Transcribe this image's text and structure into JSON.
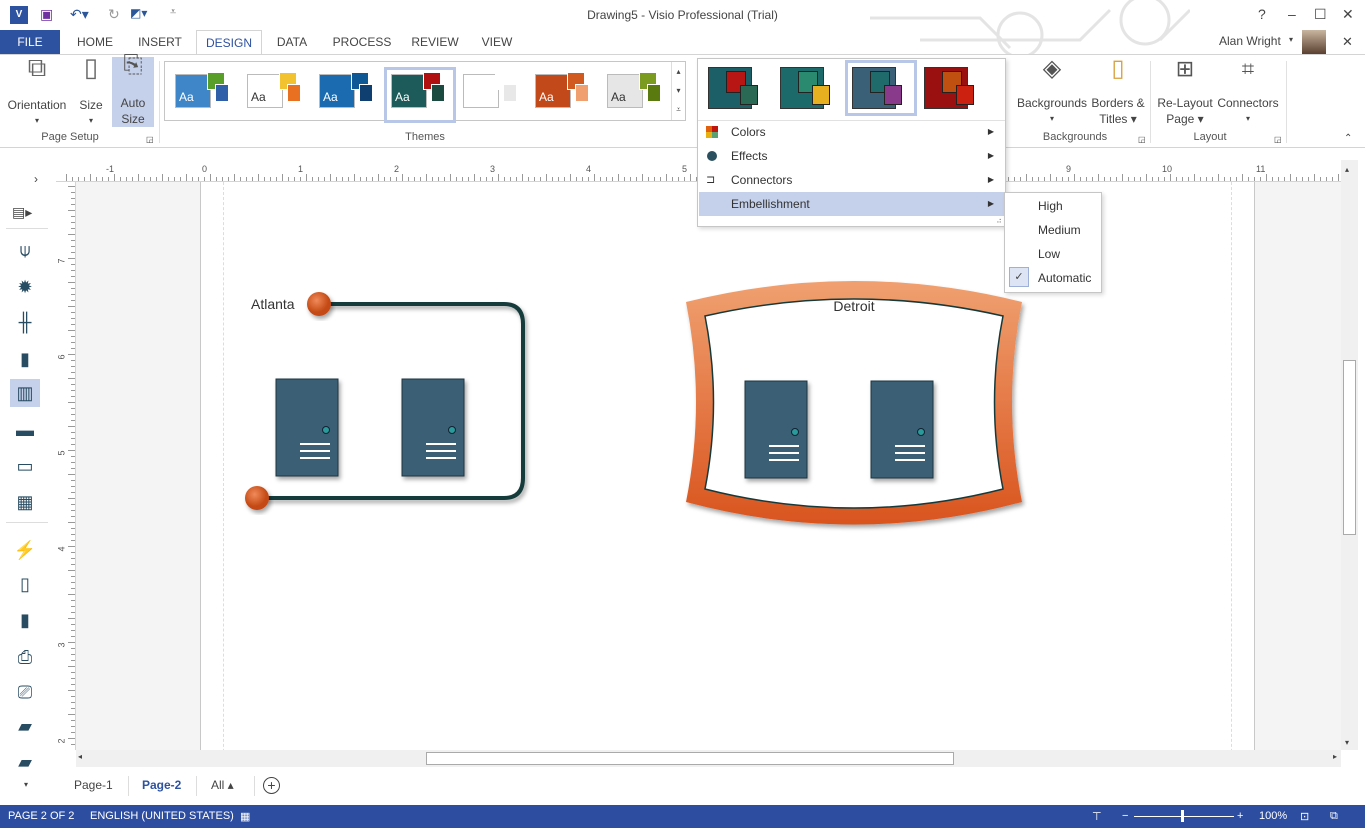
{
  "window": {
    "title": "Drawing5 - Visio Professional (Trial)",
    "user": "Alan Wright",
    "controls": [
      "?",
      "–",
      "☐",
      "✕"
    ]
  },
  "tabs": [
    {
      "label": "FILE"
    },
    {
      "label": "HOME"
    },
    {
      "label": "INSERT"
    },
    {
      "label": "DESIGN",
      "active": true
    },
    {
      "label": "DATA"
    },
    {
      "label": "PROCESS"
    },
    {
      "label": "REVIEW"
    },
    {
      "label": "VIEW"
    }
  ],
  "ribbon": {
    "page_setup": {
      "label": "Page Setup",
      "orientation": "Orientation",
      "size": "Size",
      "auto_size_1": "Auto",
      "auto_size_2": "Size"
    },
    "themes": {
      "label": "Themes",
      "sample": "Aa",
      "items": [
        {
          "bg": "#3f86c8",
          "a": "#5a9e2a",
          "b": "#2f5fa8"
        },
        {
          "bg": "#ffffff",
          "a": "#f2c230",
          "b": "#e87020"
        },
        {
          "bg": "#1b6bb0",
          "a": "#0e5896",
          "b": "#0e3f70"
        },
        {
          "bg": "#1d5a5a",
          "a": "#b01010",
          "b": "#1a4a40",
          "selected": true
        },
        {
          "bg": "#ffffff",
          "a": "#ffffff",
          "b": "#e8e8e8"
        },
        {
          "bg": "#c2491a",
          "a": "#d05a20",
          "b": "#f0a070"
        },
        {
          "bg": "#e6e6e6",
          "a": "#7a9a20",
          "b": "#5a7a10"
        }
      ]
    },
    "variants": [
      {
        "bg": "#1d5f66",
        "a": "#b81515",
        "b": "#2a6a55"
      },
      {
        "bg": "#1d6a6a",
        "a": "#2a8a70",
        "b": "#e6b020"
      },
      {
        "bg": "#3a6078",
        "a": "#1f6a6a",
        "b": "#8a3a8a",
        "selected": true
      },
      {
        "bg": "#9a1010",
        "a": "#c05010",
        "b": "#cc2010"
      }
    ],
    "backgrounds": {
      "label": "Backgrounds",
      "backgrounds": "Backgrounds",
      "borders_1": "Borders &",
      "borders_2": "Titles"
    },
    "layout": {
      "label": "Layout",
      "relayout_1": "Re-Layout",
      "relayout_2": "Page",
      "connectors": "Connectors"
    }
  },
  "variant_menu": {
    "items": [
      {
        "label": "Colors",
        "icon": "colors-icon"
      },
      {
        "label": "Effects",
        "icon": "effects-icon"
      },
      {
        "label": "Connectors",
        "icon": "connectors-icon"
      },
      {
        "label": "Embellishment",
        "highlighted": true
      }
    ]
  },
  "embellishment_submenu": {
    "items": [
      {
        "label": "High"
      },
      {
        "label": "Medium"
      },
      {
        "label": "Low"
      },
      {
        "label": "Automatic",
        "checked": true
      }
    ]
  },
  "rulers": {
    "horizontal": [
      "-1",
      "0",
      "1",
      "2",
      "3",
      "4",
      "5",
      "9",
      "10",
      "11"
    ],
    "vertical": [
      "7",
      "6",
      "5",
      "4",
      "3",
      "2"
    ]
  },
  "diagram": {
    "atlanta": "Atlanta",
    "detroit": "Detroit",
    "accent": "#d9541e",
    "server": "#3a5f74",
    "connector": "#163a3a"
  },
  "page_tabs": {
    "tabs": [
      "Page-1",
      "Page-2"
    ],
    "active": "Page-2",
    "all": "All ▴"
  },
  "status": {
    "page": "PAGE 2 OF 2",
    "language": "ENGLISH (UNITED STATES)",
    "zoom": "100%",
    "zoom_level": 100
  },
  "colors": {
    "brand": "#2d52a0"
  }
}
